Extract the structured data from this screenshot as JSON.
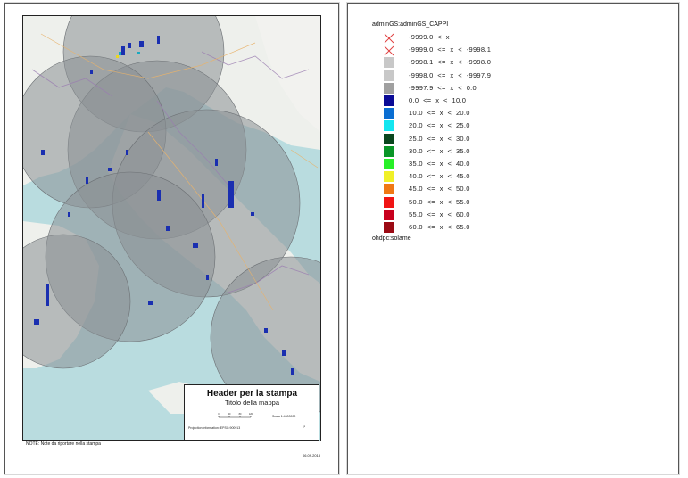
{
  "print_page": {
    "header_title": "Header per la stampa",
    "map_title": "Titolo della mappa",
    "scale_text": "Scala 1:4000000",
    "projection_text": "Projection information: EPSG:900913",
    "north_logo": "↗",
    "note": "NOTE: Note da riportare nella stampa",
    "date": "06.09.2013",
    "scalebar_labels": [
      "0",
      "40",
      "80",
      "120"
    ]
  },
  "legend": {
    "layer_title": "adminGS:adminGS_CAPPI",
    "footer_title": "ohdpc:solame",
    "entries": [
      {
        "label": "-9999.0  <  x",
        "color": "cross"
      },
      {
        "label": "-9999.0  <=  x  <  -9998.1",
        "color": "cross"
      },
      {
        "label": "-9998.1  <=  x  <  -9998.0",
        "color": "#c8c8c8"
      },
      {
        "label": "-9998.0  <=  x  <  -9997.9",
        "color": "#c8c8c8"
      },
      {
        "label": "-9997.9  <=  x  <  0.0",
        "color": "#a0a0a0"
      },
      {
        "label": "0.0  <=  x  <  10.0",
        "color": "#0a0a96"
      },
      {
        "label": "10.0  <=  x  <  20.0",
        "color": "#0a6ed2"
      },
      {
        "label": "20.0  <=  x  <  25.0",
        "color": "#14e6f0"
      },
      {
        "label": "25.0  <=  x  <  30.0",
        "color": "#0a461e"
      },
      {
        "label": "30.0  <=  x  <  35.0",
        "color": "#0a9628"
      },
      {
        "label": "35.0  <=  x  <  40.0",
        "color": "#28f028"
      },
      {
        "label": "40.0  <=  x  <  45.0",
        "color": "#f0f028"
      },
      {
        "label": "45.0  <=  x  <  50.0",
        "color": "#f07814"
      },
      {
        "label": "50.0  <=  x  <  55.0",
        "color": "#f01414"
      },
      {
        "label": "55.0  <=  x  <  60.0",
        "color": "#c8001e"
      },
      {
        "label": "60.0  <=  x  <  65.0",
        "color": "#9b0a14"
      }
    ]
  }
}
